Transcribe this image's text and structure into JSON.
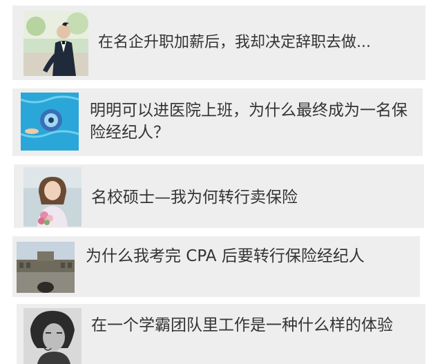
{
  "articles": [
    {
      "title": "在名企升职加薪后，我却决定辞职去做...",
      "thumbnail": "man-in-suit-photo"
    },
    {
      "title": "明明可以进医院上班，为什么最终成为一名保险经纪人？",
      "thumbnail": "swimming-pool-photo"
    },
    {
      "title": "名校硕士—我为何转行卖保险",
      "thumbnail": "woman-with-flowers-photo"
    },
    {
      "title": "为什么我考完 CPA 后要转行保险经纪人",
      "thumbnail": "building-photo"
    },
    {
      "title": "在一个学霸团队里工作是一种什么样的体验",
      "thumbnail": "bw-portrait-photo"
    }
  ],
  "colors": {
    "card_bg": "#eeeeee",
    "text": "#333333",
    "page_bg": "#ffffff"
  }
}
